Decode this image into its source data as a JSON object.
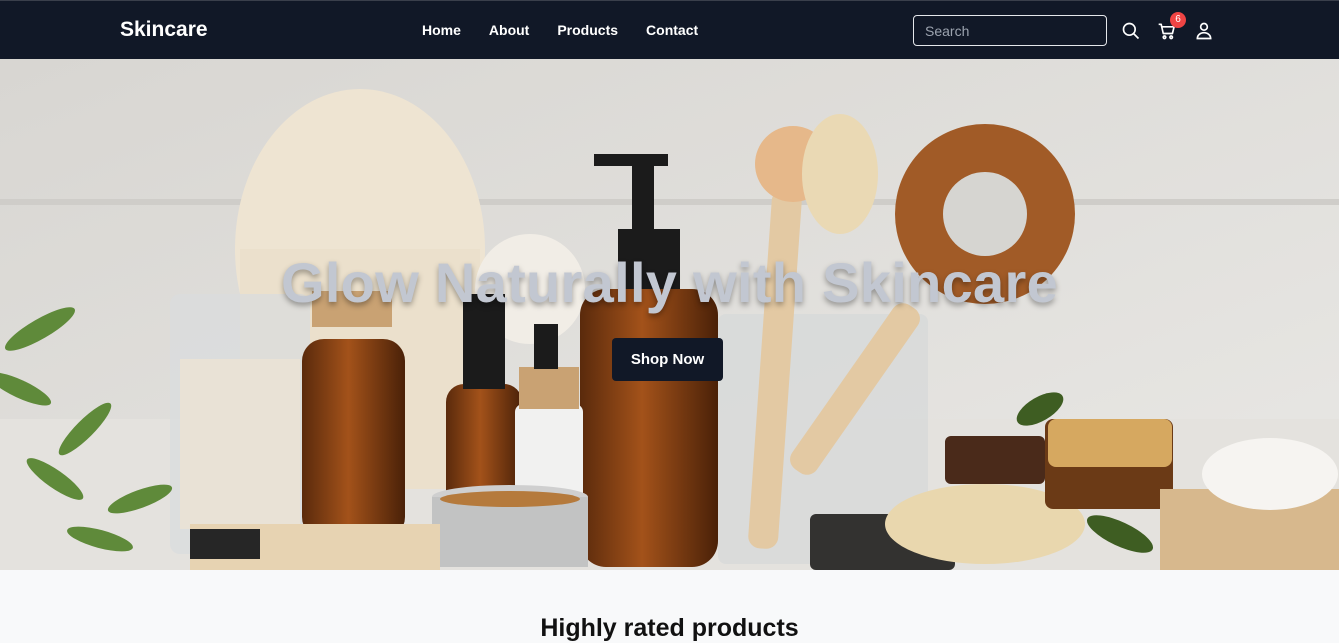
{
  "header": {
    "brand": "Skincare",
    "nav": [
      "Home",
      "About",
      "Products",
      "Contact"
    ],
    "search_placeholder": "Search",
    "cart_count": "6",
    "icons": [
      "search-icon",
      "cart-icon",
      "user-icon"
    ]
  },
  "hero": {
    "title": "Glow Naturally with Skincare",
    "cta": "Shop Now"
  },
  "section": {
    "title": "Highly rated products"
  },
  "colors": {
    "nav_bg": "#111827",
    "badge": "#ef4444",
    "button_bg": "#111827",
    "page_bg": "#f8f9fa"
  }
}
